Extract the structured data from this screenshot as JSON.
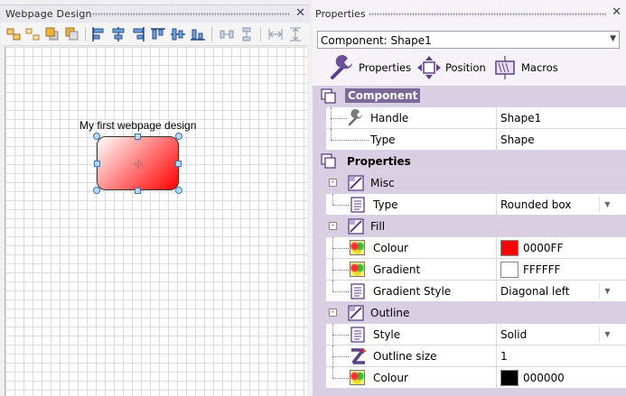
{
  "left_panel": {
    "title": "Webpage Design",
    "close_glyph": "✕",
    "canvas": {
      "shape_label": "My first webpage design"
    }
  },
  "right_panel": {
    "title": "Properties",
    "close_glyph": "✕",
    "component_select": {
      "value": "Component: Shape1"
    },
    "tabs": [
      {
        "label": "Properties",
        "icon": "wrench-icon"
      },
      {
        "label": "Position",
        "icon": "move-arrows-icon"
      },
      {
        "label": "Macros",
        "icon": "macros-icon"
      }
    ],
    "component_section": {
      "title": "Component",
      "rows": [
        {
          "label": "Handle",
          "value": "Shape1"
        },
        {
          "label": "Type",
          "value": "Shape"
        }
      ]
    },
    "properties_section": {
      "title": "Properties",
      "misc": {
        "title": "Misc",
        "rows": [
          {
            "label": "Type",
            "value": "Rounded box"
          }
        ]
      },
      "fill": {
        "title": "Fill",
        "colour": {
          "label": "Colour",
          "value": "0000FF",
          "swatch": "#ff0000"
        },
        "gradient": {
          "label": "Gradient",
          "value": "FFFFFF",
          "swatch": "#ffffff"
        },
        "gradient_style": {
          "label": "Gradient Style",
          "value": "Diagonal left"
        }
      },
      "outline": {
        "title": "Outline",
        "style": {
          "label": "Style",
          "value": "Solid"
        },
        "size": {
          "label": "Outline size",
          "value": "1"
        },
        "colour": {
          "label": "Colour",
          "value": "000000",
          "swatch": "#000000"
        }
      }
    }
  },
  "colors": {
    "accent": "#6b5a8e",
    "header_bg": "#d8cfe2",
    "shape_fill_end": "#ff0000"
  }
}
